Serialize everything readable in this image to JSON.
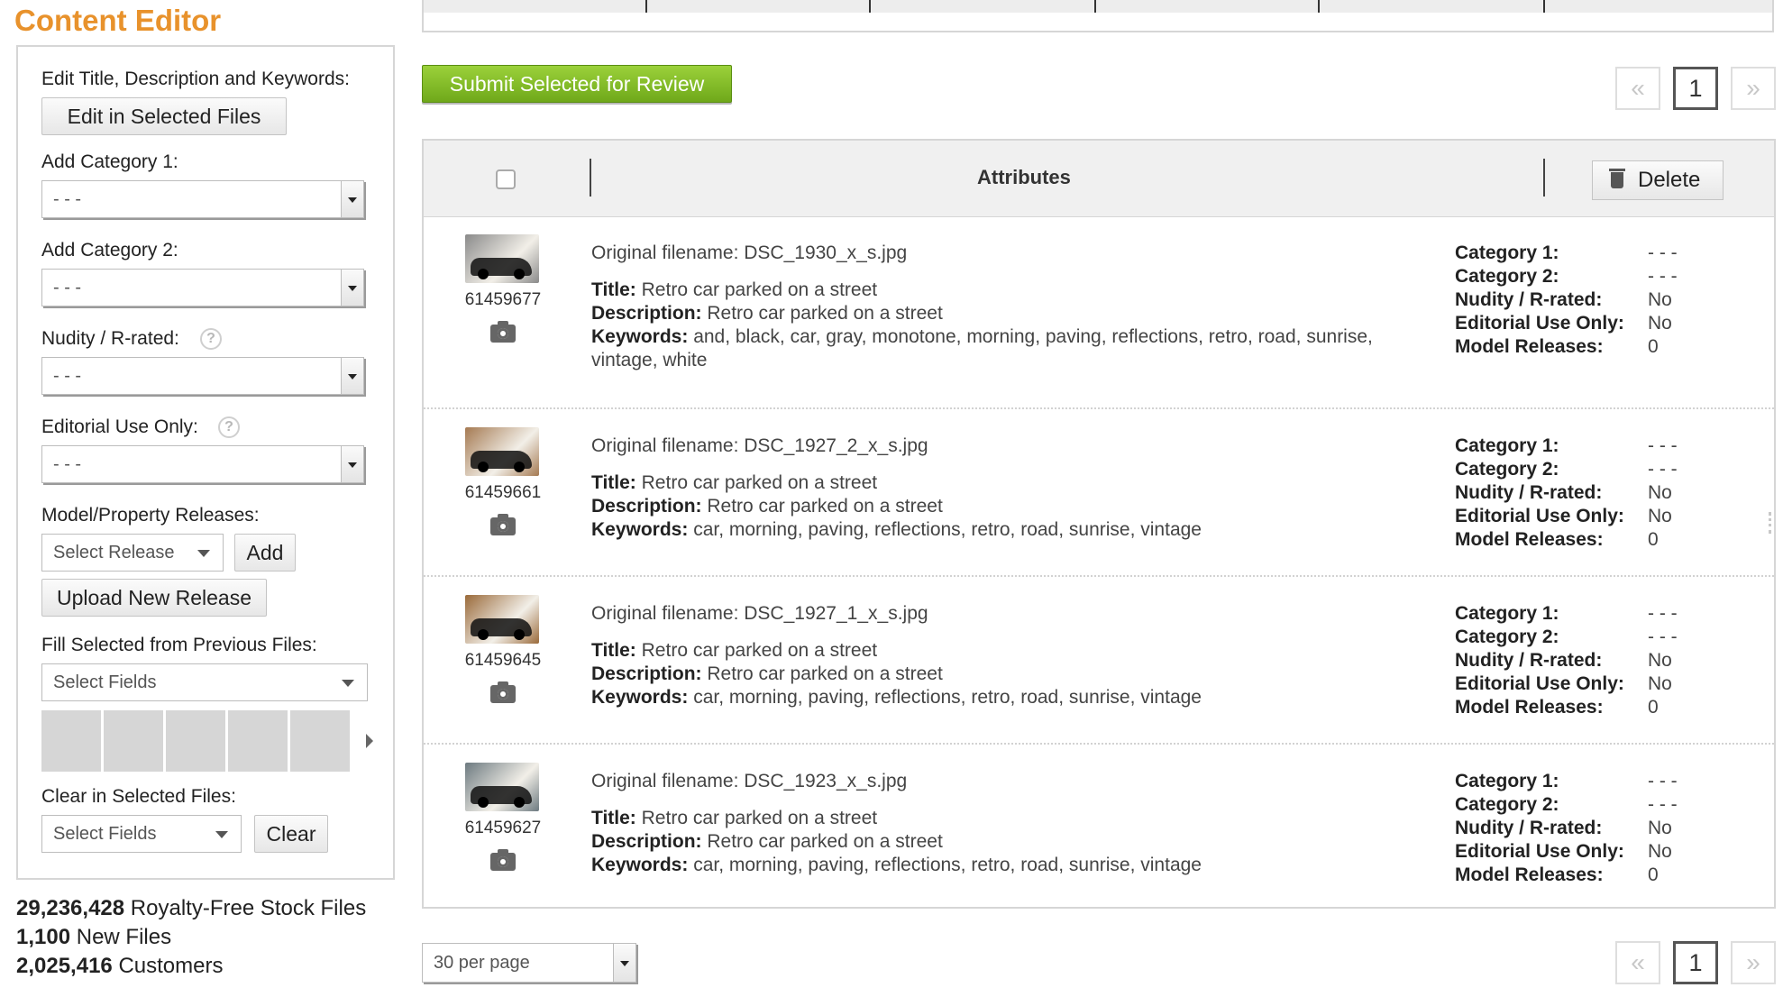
{
  "page": {
    "title": "Content Editor"
  },
  "sidebar": {
    "edit_label": "Edit Title, Description and Keywords:",
    "edit_button": "Edit in Selected Files",
    "cat1_label": "Add Category 1:",
    "cat1_value": "- - -",
    "cat2_label": "Add Category 2:",
    "cat2_value": "- - -",
    "nudity_label": "Nudity / R-rated:",
    "nudity_value": "- - -",
    "editorial_label": "Editorial Use Only:",
    "editorial_value": "- - -",
    "help_glyph": "?",
    "releases_label": "Model/Property Releases:",
    "release_select": "Select Release",
    "add_button": "Add",
    "upload_button": "Upload New Release",
    "fill_label": "Fill Selected from Previous Files:",
    "fill_select": "Select Fields",
    "clear_label": "Clear in Selected Files:",
    "clear_select": "Select Fields",
    "clear_button": "Clear"
  },
  "stats": [
    {
      "value": "29,236,428",
      "text": " Royalty-Free Stock Files"
    },
    {
      "value": "1,100",
      "text": " New Files"
    },
    {
      "value": "2,025,416",
      "text": " Customers"
    }
  ],
  "toolbar": {
    "submit_label": "Submit Selected for Review"
  },
  "pager": {
    "prev": "«",
    "current": "1",
    "next": "»"
  },
  "table": {
    "header_title": "Attributes",
    "delete_label": "Delete",
    "labels": {
      "filename": "Original filename: ",
      "title": "Title:",
      "description": "Description:",
      "keywords": "Keywords:",
      "cat1": "Category 1:",
      "cat2": "Category 2:",
      "nudity": "Nudity / R-rated:",
      "editorial": "Editorial Use Only:",
      "releases": "Model Releases:"
    },
    "rows": [
      {
        "id": "61459677",
        "filename": "DSC_1930_x_s.jpg",
        "title": "Retro car parked on a street",
        "description": "Retro car parked on a street",
        "keywords": "and, black, car, gray, monotone, morning, paving, reflections, retro, road, sunrise, vintage, white",
        "cat1": "- - -",
        "cat2": "- - -",
        "nudity": "No",
        "editorial": "No",
        "releases": "0",
        "thumb_color": "#8a8a8a"
      },
      {
        "id": "61459661",
        "filename": "DSC_1927_2_x_s.jpg",
        "title": "Retro car parked on a street",
        "description": "Retro car parked on a street",
        "keywords": "car, morning, paving, reflections, retro, road, sunrise, vintage",
        "cat1": "- - -",
        "cat2": "- - -",
        "nudity": "No",
        "editorial": "No",
        "releases": "0",
        "thumb_color": "#a57a52"
      },
      {
        "id": "61459645",
        "filename": "DSC_1927_1_x_s.jpg",
        "title": "Retro car parked on a street",
        "description": "Retro car parked on a street",
        "keywords": "car, morning, paving, reflections, retro, road, sunrise, vintage",
        "cat1": "- - -",
        "cat2": "- - -",
        "nudity": "No",
        "editorial": "No",
        "releases": "0",
        "thumb_color": "#9a6a3a"
      },
      {
        "id": "61459627",
        "filename": "DSC_1923_x_s.jpg",
        "title": "Retro car parked on a street",
        "description": "Retro car parked on a street",
        "keywords": "car, morning, paving, reflections, retro, road, sunrise, vintage",
        "cat1": "- - -",
        "cat2": "- - -",
        "nudity": "No",
        "editorial": "No",
        "releases": "0",
        "thumb_color": "#6d7a80"
      }
    ]
  },
  "footer": {
    "per_page": "30 per page"
  },
  "colors": {
    "accent": "#e8922c",
    "submit_green": "#7cb82a"
  }
}
